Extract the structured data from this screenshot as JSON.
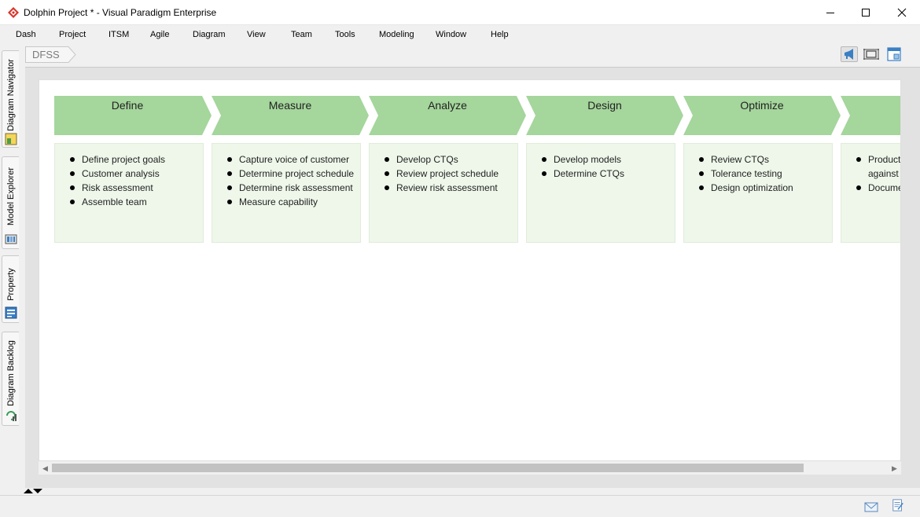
{
  "window": {
    "title": "Dolphin Project * - Visual Paradigm Enterprise",
    "controls": [
      "minimize",
      "maximize",
      "close"
    ]
  },
  "menu": [
    "Dash",
    "Project",
    "ITSM",
    "Agile",
    "Diagram",
    "View",
    "Team",
    "Tools",
    "Modeling",
    "Window",
    "Help"
  ],
  "breadcrumb": {
    "label": "DFSS"
  },
  "toolbar_icons": [
    "megaphone-icon",
    "fit-size-icon",
    "diagram-overview-icon"
  ],
  "side_tabs": [
    {
      "label": "Diagram Navigator",
      "icon": "diagram-navigator-icon"
    },
    {
      "label": "Model Explorer",
      "icon": "model-explorer-icon"
    },
    {
      "label": "Property",
      "icon": "property-icon"
    },
    {
      "label": "Diagram Backlog",
      "icon": "diagram-backlog-icon"
    }
  ],
  "colors": {
    "phase_header": "#a5d69c",
    "phase_box": "#eef7ea",
    "canvas": "#ffffff",
    "accent_red": "#d9342b"
  },
  "phases": [
    {
      "title": "Define",
      "items": [
        "Define project goals",
        "Customer analysis",
        "Risk assessment",
        "Assemble team"
      ]
    },
    {
      "title": "Measure",
      "items": [
        "Capture voice of customer",
        "Determine project schedule",
        "Determine risk assessment",
        "Measure capability"
      ]
    },
    {
      "title": "Analyze",
      "items": [
        "Develop CTQs",
        "Review project schedule",
        "Review risk assessment"
      ]
    },
    {
      "title": "Design",
      "items": [
        "Develop models",
        "Determine CTQs"
      ]
    },
    {
      "title": "Optimize",
      "items": [
        "Review CTQs",
        "Tolerance testing",
        "Design optimization"
      ]
    },
    {
      "title": "",
      "items": [
        "Product against",
        "Docume"
      ]
    }
  ],
  "status_icons": [
    "mail-icon",
    "notes-icon"
  ]
}
